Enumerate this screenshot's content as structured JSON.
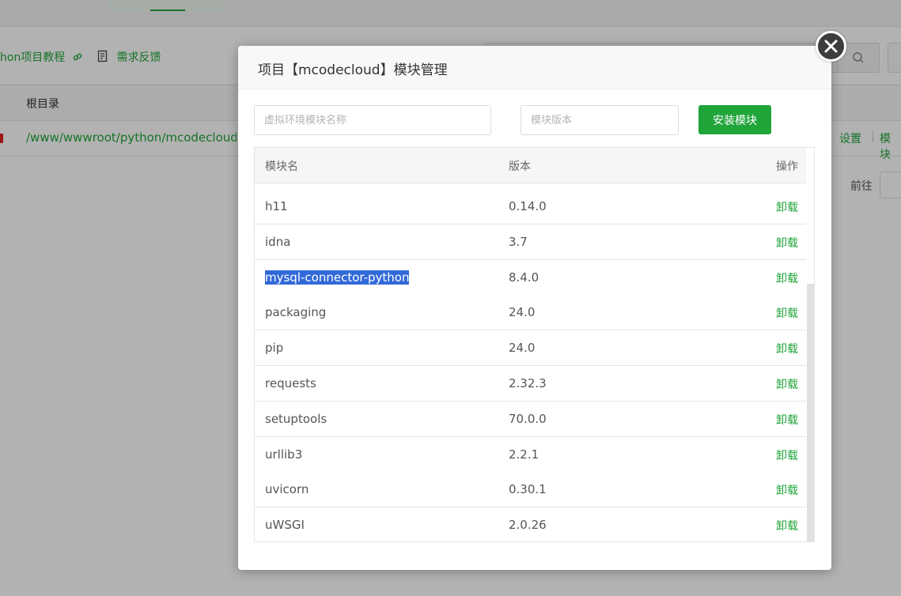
{
  "background": {
    "toolbar_links": [
      "hon项目教程",
      "需求反馈"
    ],
    "header_label": "根目录",
    "row_path": "/www/wwwroot/python/mcodecloud",
    "row_actions": [
      "设置",
      "|",
      "模块"
    ],
    "pagination_goto": "前往"
  },
  "modal": {
    "title": "项目【mcodecloud】模块管理",
    "module_name_placeholder": "虚拟环境模块名称",
    "module_version_placeholder": "模块版本",
    "install_button": "安装模块",
    "columns": [
      "模块名",
      "版本",
      "操作"
    ],
    "rows": [
      {
        "name": "h11",
        "version": "0.14.0",
        "action": "卸载"
      },
      {
        "name": "idna",
        "version": "3.7",
        "action": "卸载"
      },
      {
        "name": "mysql-connector-python",
        "version": "8.4.0",
        "action": "卸载",
        "selected": true
      },
      {
        "name": "packaging",
        "version": "24.0",
        "action": "卸载"
      },
      {
        "name": "pip",
        "version": "24.0",
        "action": "卸载"
      },
      {
        "name": "requests",
        "version": "2.32.3",
        "action": "卸载"
      },
      {
        "name": "setuptools",
        "version": "70.0.0",
        "action": "卸载"
      },
      {
        "name": "urllib3",
        "version": "2.2.1",
        "action": "卸载"
      },
      {
        "name": "uvicorn",
        "version": "0.30.1",
        "action": "卸载"
      },
      {
        "name": "uWSGI",
        "version": "2.0.26",
        "action": "卸载"
      }
    ]
  },
  "colors": {
    "accent": "#20a53a",
    "selection": "#3269d8",
    "close_button": "#3d3d3d"
  }
}
